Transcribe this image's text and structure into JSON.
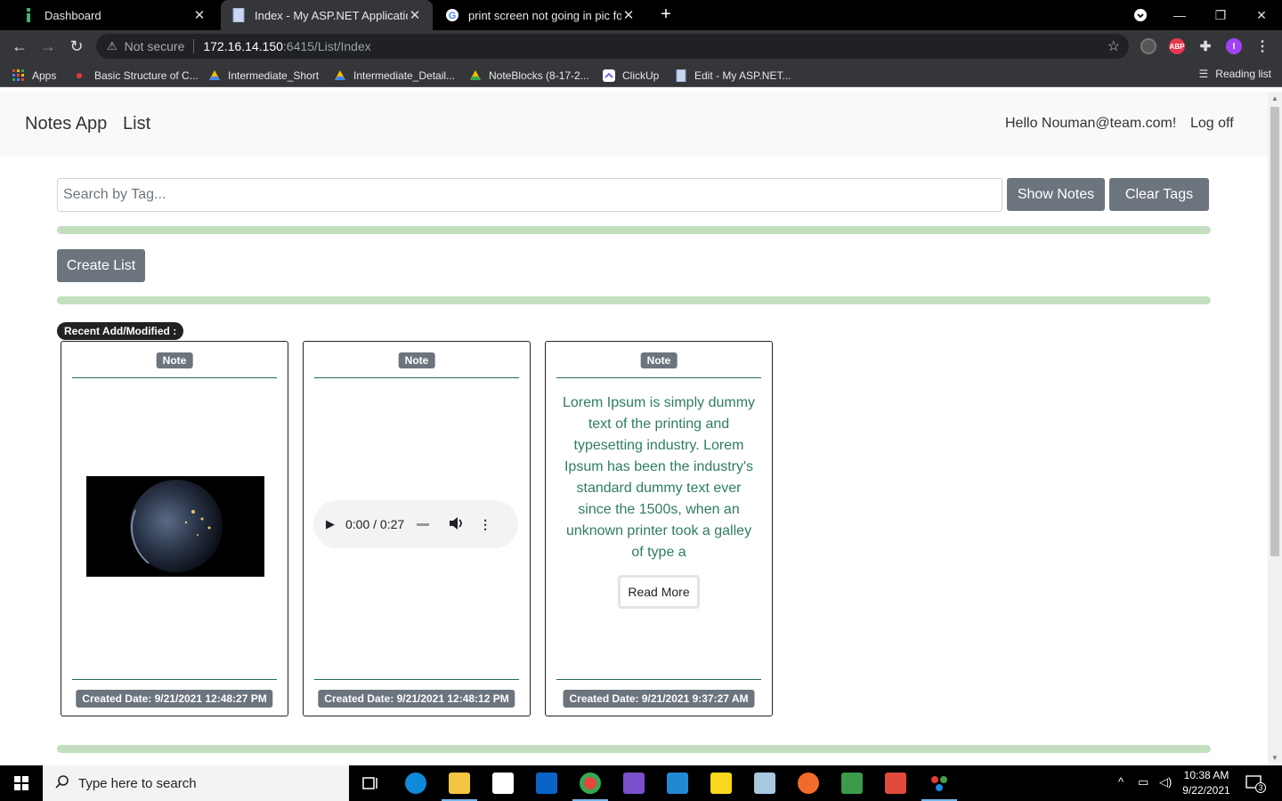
{
  "browser": {
    "tabs": [
      {
        "title": "Dashboard",
        "active": false
      },
      {
        "title": "Index - My ASP.NET Application",
        "active": true
      },
      {
        "title": "print screen not going in pic fold",
        "active": false
      }
    ],
    "address": {
      "security_label": "Not secure",
      "host": "172.16.14.150",
      "path": ":6415/List/Index"
    },
    "extension_abp": "ABP",
    "profile_initial": "I",
    "bookmarks": [
      "Apps",
      "Basic Structure of C...",
      "Intermediate_Short",
      "Intermediate_Detail...",
      "NoteBlocks (8-17-2...",
      "ClickUp",
      "Edit - My ASP.NET..."
    ],
    "reading_list": "Reading list"
  },
  "navbar": {
    "brand": "Notes App",
    "list_link": "List",
    "greeting": "Hello Nouman@team.com!",
    "logoff": "Log off"
  },
  "search": {
    "placeholder": "Search by Tag...",
    "show_notes": "Show Notes",
    "clear_tags": "Clear Tags"
  },
  "create_list": "Create List",
  "recent_label": "Recent Add/Modified :",
  "cards": [
    {
      "badge": "Note",
      "content_type": "image",
      "created": "Created Date:  9/21/2021 12:48:27 PM"
    },
    {
      "badge": "Note",
      "content_type": "audio",
      "audio_time": "0:00 / 0:27",
      "created": "Created Date:  9/21/2021 12:48:12 PM"
    },
    {
      "badge": "Note",
      "content_type": "text",
      "text": "Lorem Ipsum is simply dummy text of the printing and typesetting industry. Lorem Ipsum has been the industry's standard dummy text ever since the 1500s, when an unknown printer took a galley of type a",
      "read_more": "Read More",
      "created": "Created Date:  9/21/2021 9:37:27 AM"
    }
  ],
  "taskbar": {
    "search_placeholder": "Type here to search",
    "time": "10:38 AM",
    "date": "9/22/2021",
    "notifications": "3"
  },
  "colors": {
    "divider": "#c3dfc0",
    "button": "#6c757d",
    "card_text": "#2e7d62"
  }
}
